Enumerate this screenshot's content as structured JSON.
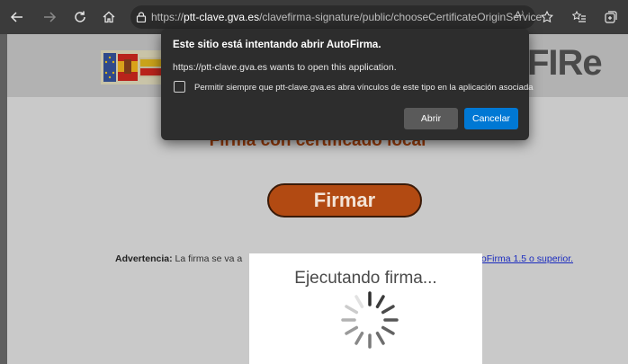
{
  "browser": {
    "url_prefix": "https://",
    "url_domain": "ptt-clave.gva.es",
    "url_path": "/clavefirma-signature/public/chooseCertificateOriginService",
    "read_aloud": "A⁾"
  },
  "page": {
    "logo_text": "FIRe",
    "title": "Firma con certificado local",
    "sign_button": "Firmar",
    "warning_label": "Advertencia:",
    "warning_text": "La firma se va a",
    "warning_link": "toFirma 1.5 o superior."
  },
  "spinner_panel": {
    "title": "Ejecutando firma..."
  },
  "dialog": {
    "title": "Este sitio está intentando abrir AutoFirma.",
    "subtitle": "https://ptt-clave.gva.es wants to open this application.",
    "checkbox_label": "Permitir siempre que ptt-clave.gva.es abra vínculos de este tipo en la aplicación asociada",
    "checkbox_checked": false,
    "open_button": "Abrir",
    "cancel_button": "Cancelar"
  },
  "colors": {
    "accent": "#0078d4",
    "sign_button": "#b24a12",
    "title": "#9b3d0b"
  }
}
